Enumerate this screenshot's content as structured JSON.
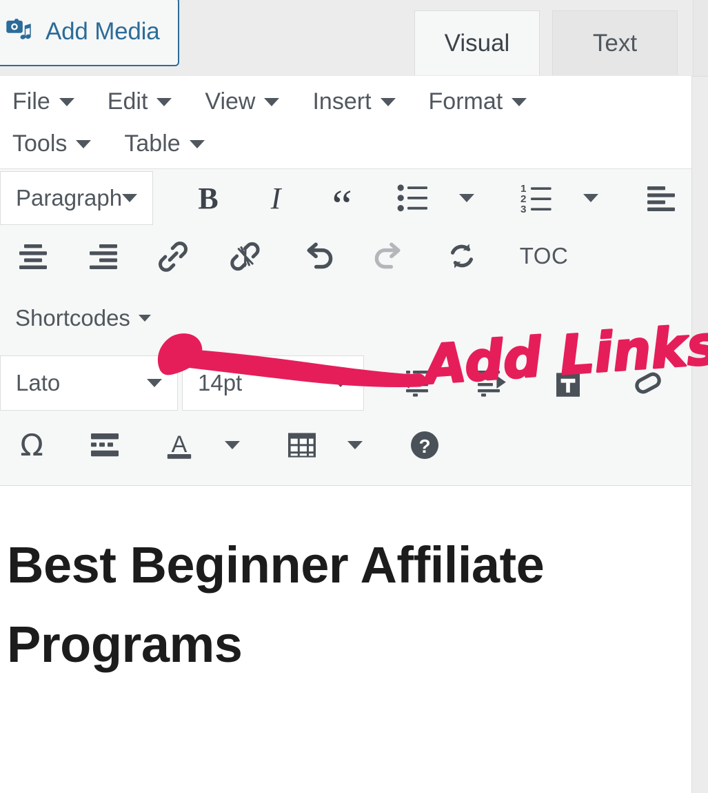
{
  "topbar": {
    "add_media_label": "Add Media",
    "add_media_icon": "media-camera-music-icon",
    "tabs": [
      {
        "label": "Visual",
        "active": true
      },
      {
        "label": "Text",
        "active": false
      }
    ]
  },
  "menubar": {
    "row1": [
      {
        "label": "File"
      },
      {
        "label": "Edit"
      },
      {
        "label": "View"
      },
      {
        "label": "Insert"
      },
      {
        "label": "Format"
      }
    ],
    "row2": [
      {
        "label": "Tools"
      },
      {
        "label": "Table"
      }
    ]
  },
  "toolbar": {
    "row1": {
      "block_format": "Paragraph",
      "bold": "B",
      "italic": "I",
      "blockquote": "“",
      "bullet_list": "bullet-list-icon",
      "bullet_list_caret": "chevron-down-icon",
      "numbered_list": "numbered-list-icon",
      "numbered_list_caret": "chevron-down-icon",
      "align_left": "align-left-icon"
    },
    "row2": {
      "align_center": "align-center-icon",
      "align_right": "align-right-icon",
      "link": "link-icon",
      "unlink": "unlink-icon",
      "undo": "undo-icon",
      "redo": "redo-icon",
      "sync": "sync-icon",
      "toc_label": "TOC"
    },
    "row3": {
      "shortcodes_label": "Shortcodes",
      "shortcodes_caret": "chevron-down-icon"
    },
    "row4": {
      "font_family": "Lato",
      "font_size": "14pt",
      "outdent": "outdent-icon",
      "indent": "indent-icon",
      "paste_as_text": "paste-as-text-icon",
      "clear_formatting": "eraser-icon"
    },
    "row5": {
      "special_character": "Ω",
      "page_break": "page-break-icon",
      "text_color": "A",
      "text_color_caret": "chevron-down-icon",
      "table": "table-icon",
      "table_caret": "chevron-down-icon",
      "help": "help-icon"
    }
  },
  "content": {
    "post_title": "Best Beginner Affiliate Programs"
  },
  "annotation": {
    "text": "Add Links",
    "color": "#e51e5a",
    "arrow": "hand-drawn-arrow-pointing-left"
  },
  "colors": {
    "accent_blue": "#2b6c99",
    "toolbar_bg": "#f6f7f7",
    "topbar_bg": "#ececec",
    "icon_gray": "#50575e",
    "annotation_pink": "#e51e5a"
  }
}
